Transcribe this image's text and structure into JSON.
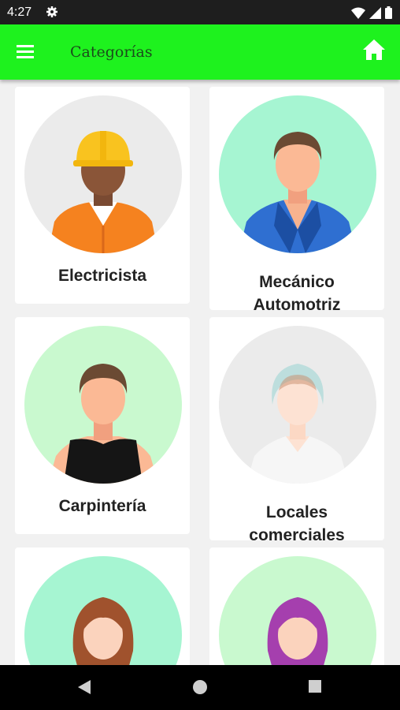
{
  "status_bar": {
    "time": "4:27"
  },
  "app_bar": {
    "title": "Categorías"
  },
  "categories": [
    {
      "label": "Electricista"
    },
    {
      "label": "Mecánico\nAutomotriz"
    },
    {
      "label": "Carpintería"
    },
    {
      "label": "Locales\ncomerciales"
    },
    {
      "label": ""
    },
    {
      "label": ""
    }
  ],
  "colors": {
    "status_bar": "#1e1e1e",
    "app_bar": "#1ef21e",
    "app_bar_title": "#1b4b1b",
    "circle_gray": "#ebebeb",
    "circle_mint": "#a6f5d2",
    "circle_light_green": "#c9f9cf",
    "nav_bar": "#000000"
  }
}
